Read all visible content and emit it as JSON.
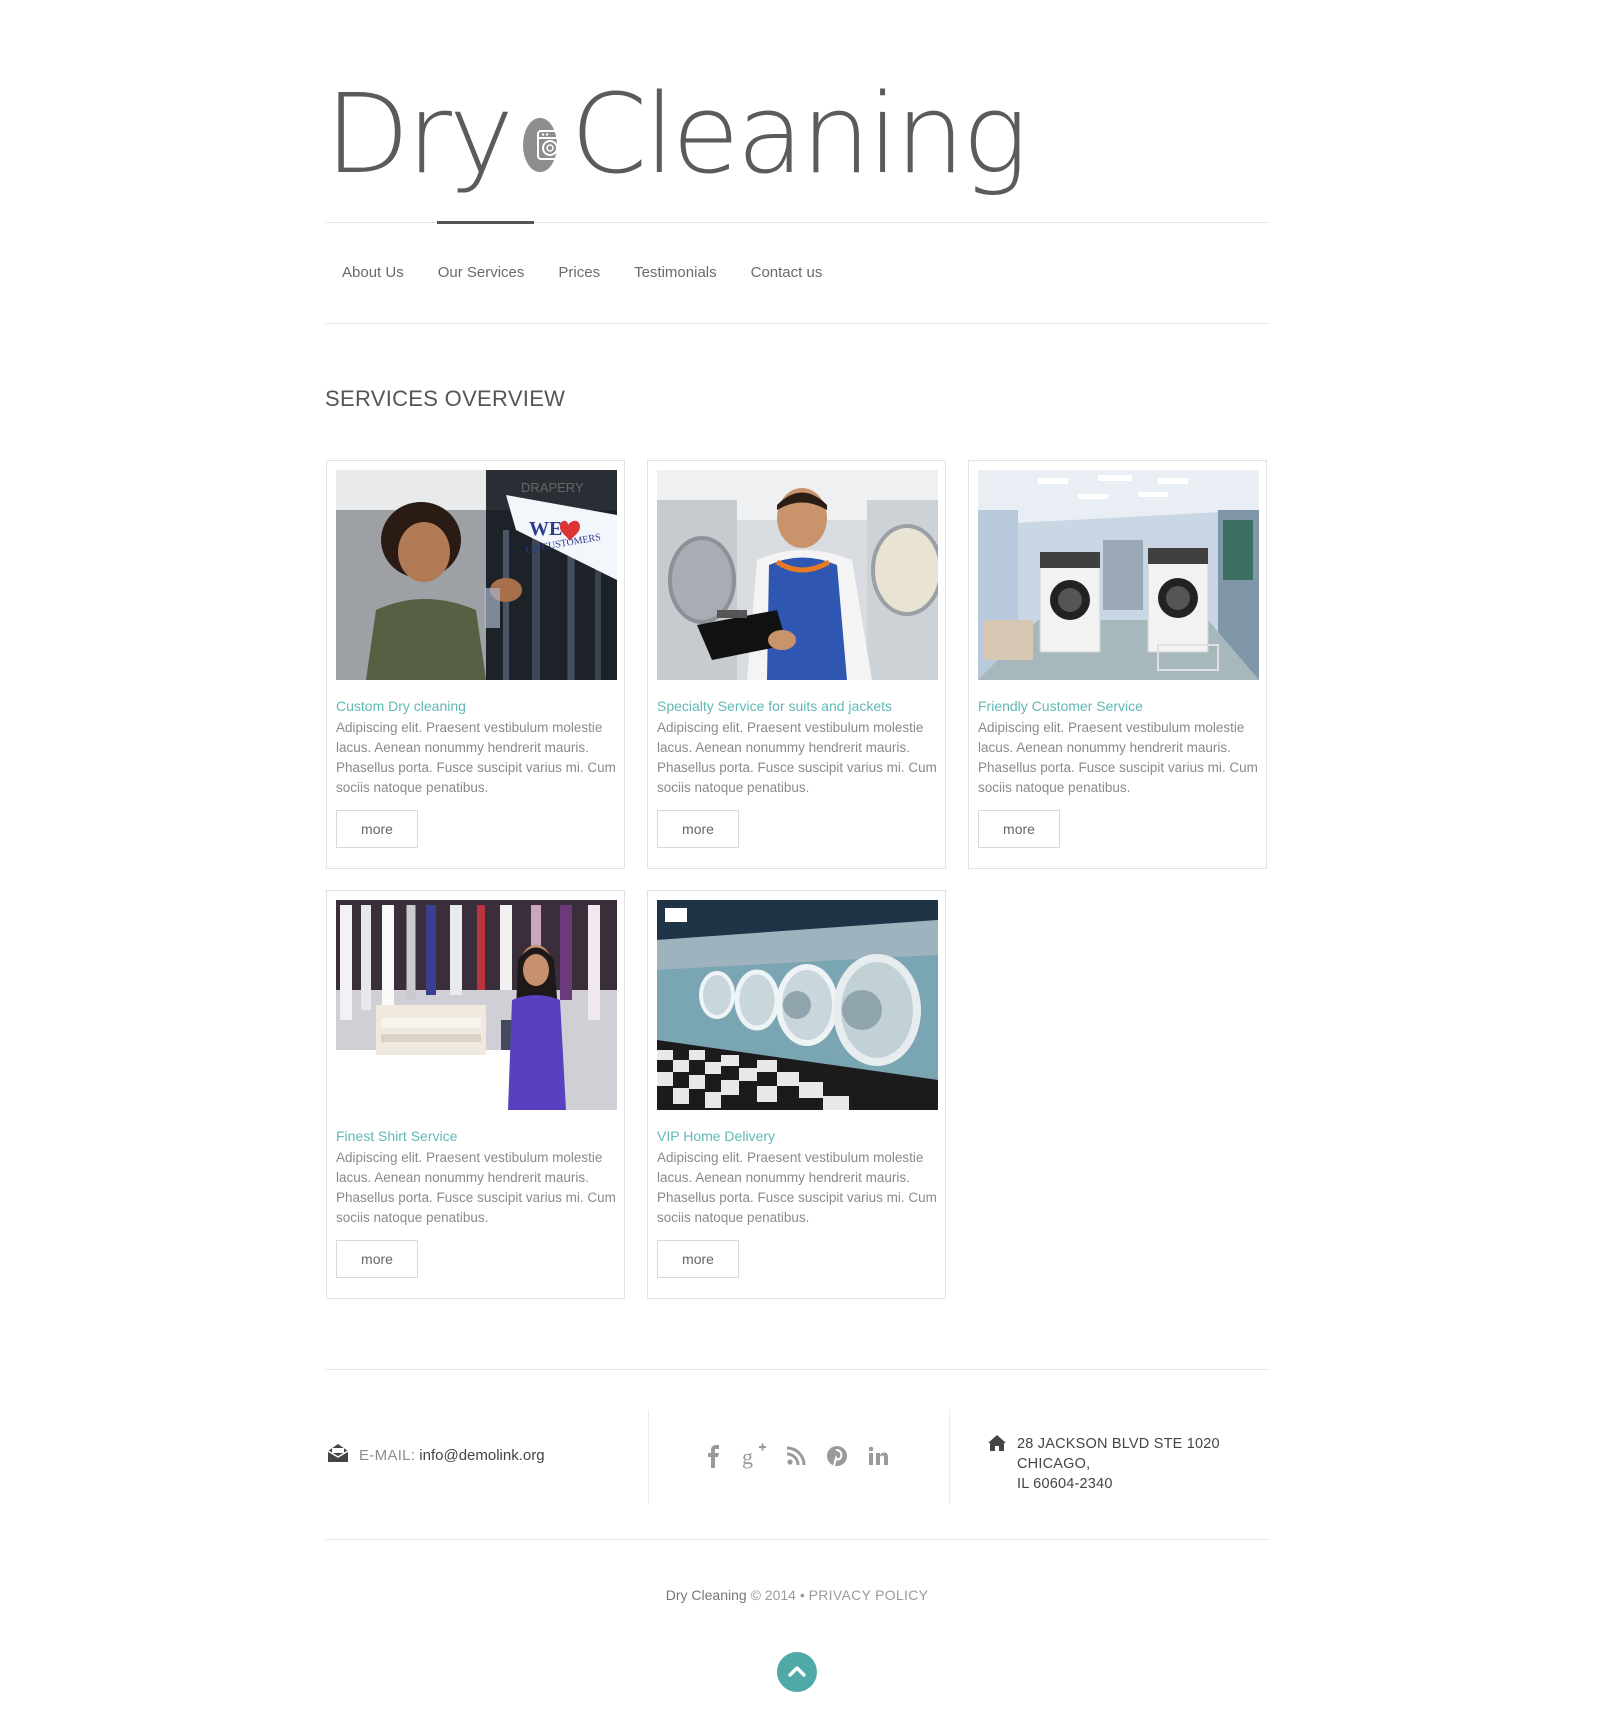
{
  "header": {
    "logo_word1": "Dry",
    "logo_word2": "Cleaning"
  },
  "nav": {
    "active": "Our Services",
    "items": [
      "About Us",
      "Our Services",
      "Prices",
      "Testimonials",
      "Contact us"
    ]
  },
  "main": {
    "section_title": "SERVICES OVERVIEW",
    "cards": [
      {
        "title": "Custom Dry cleaning",
        "text": "Adipiscing elit. Praesent vestibulum molestie lacus. Aenean nonummy hendrerit mauris. Phasellus porta. Fusce suscipit varius mi. Cum sociis natoque penatibus.",
        "button": "more",
        "sign_text_1": "DRAPERY",
        "sign_text_2": "WE",
        "sign_text_3": "UR CUSTOMERS"
      },
      {
        "title": "Specialty Service for suits and jackets",
        "text": "Adipiscing elit. Praesent vestibulum molestie lacus. Aenean nonummy hendrerit mauris. Phasellus porta. Fusce suscipit varius mi. Cum sociis natoque penatibus.",
        "button": "more"
      },
      {
        "title": "Friendly Customer Service",
        "text": "Adipiscing elit. Praesent vestibulum molestie lacus. Aenean nonummy hendrerit mauris. Phasellus porta. Fusce suscipit varius mi. Cum sociis natoque penatibus.",
        "button": "more"
      },
      {
        "title": "Finest Shirt Service",
        "text": "Adipiscing elit. Praesent vestibulum molestie lacus. Aenean nonummy hendrerit mauris. Phasellus porta. Fusce suscipit varius mi. Cum sociis natoque penatibus.",
        "button": "more"
      },
      {
        "title": "VIP Home Delivery",
        "text": "Adipiscing elit. Praesent vestibulum molestie lacus. Aenean nonummy hendrerit mauris. Phasellus porta. Fusce suscipit varius mi. Cum sociis natoque penatibus.",
        "button": "more"
      }
    ]
  },
  "footer": {
    "email_label": "E-MAIL:",
    "email_value": "info@demolink.org",
    "social_icons": [
      "facebook-icon",
      "google-plus-icon",
      "rss-icon",
      "pinterest-icon",
      "linkedin-icon"
    ],
    "address_line1": "28 JACKSON BLVD STE 1020 CHICAGO,",
    "address_line2": "IL 60604-2340",
    "copyright_brand": "Dry Cleaning",
    "copyright_year": "© 2014",
    "separator": "•",
    "privacy": "PRIVACY POLICY"
  },
  "colors": {
    "accent": "#5fb8b4",
    "to_top": "#4fa9a6",
    "text": "#8a8a8a",
    "heading": "#555555"
  }
}
